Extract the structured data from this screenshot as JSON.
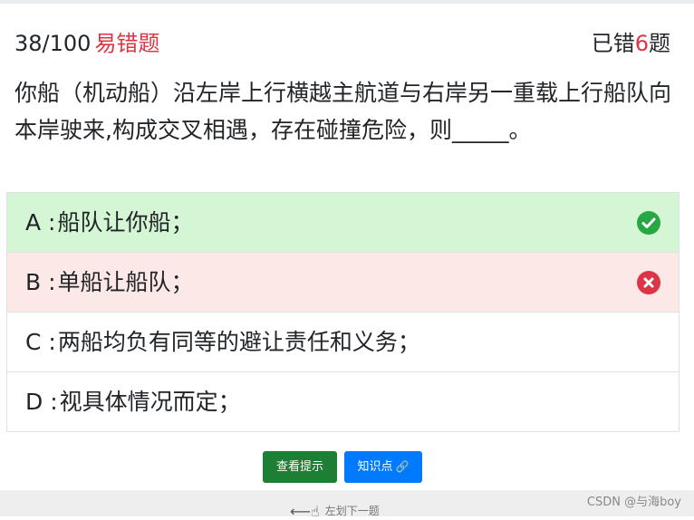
{
  "header": {
    "progress": "38/100",
    "tag": "易错题",
    "wrong_prefix": "已错",
    "wrong_count": "6",
    "wrong_suffix": "题"
  },
  "question": {
    "text": "你船（机动船）沿左岸上行横越主航道与右岸另一重载上行船队向本岸驶来,构成交叉相遇，存在碰撞危险，则_____。"
  },
  "options": [
    {
      "label": "A :",
      "text": "船队让你船；",
      "status": "correct",
      "icon": "check-circle-icon"
    },
    {
      "label": "B :",
      "text": "单船让船队；",
      "status": "wrong",
      "icon": "times-circle-icon"
    },
    {
      "label": "C :",
      "text": "两船均负有同等的避让责任和义务；",
      "status": "none"
    },
    {
      "label": "D :",
      "text": "视具体情况而定；",
      "status": "none"
    }
  ],
  "buttons": {
    "hint": "查看提示",
    "knowledge": "知识点"
  },
  "footer": {
    "swipe_text": "左划下一题",
    "credit": "CSDN @与海boy"
  },
  "colors": {
    "correct_bg": "#d4f6d4",
    "wrong_bg": "#fde8e8",
    "accent_red": "#dc3545",
    "green_icon": "#28a745",
    "hint_btn": "#1e7e34",
    "knowledge_btn": "#007bff"
  }
}
